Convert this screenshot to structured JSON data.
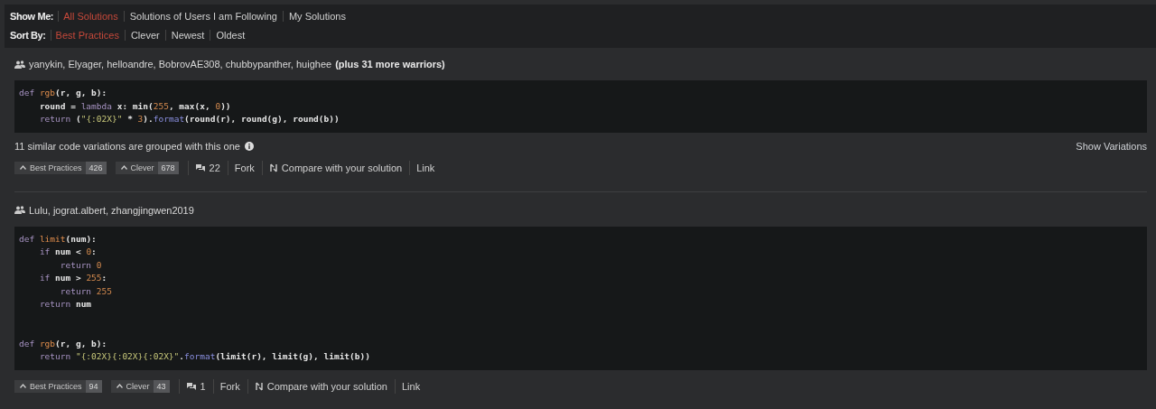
{
  "filters": [
    {
      "label": "Show Me:",
      "options": [
        {
          "label": "All Solutions",
          "selected": true
        },
        {
          "label": "Solutions of Users I am Following",
          "selected": false
        },
        {
          "label": "My Solutions",
          "selected": false
        }
      ]
    },
    {
      "label": "Sort By:",
      "options": [
        {
          "label": "Best Practices",
          "selected": true
        },
        {
          "label": "Clever",
          "selected": false
        },
        {
          "label": "Newest",
          "selected": false
        },
        {
          "label": "Oldest",
          "selected": false
        }
      ]
    }
  ],
  "solutions": [
    {
      "authors": "yanykin, Elyager, helloandre, BobrovAE308, chubbypanther, huighee",
      "more": "(plus 31 more warriors)",
      "code": [
        {
          "kind": "code",
          "tokens": [
            {
              "t": "def ",
              "kind": "keyword"
            },
            {
              "t": "rgb",
              "kind": "function"
            },
            {
              "t": "(r, g, b):",
              "kind": "plain"
            }
          ],
          "children": [
            {
              "kind": "code",
              "tokens": [
                {
                  "t": "round = ",
                  "kind": "plain"
                },
                {
                  "t": "lambda",
                  "kind": "keyword"
                },
                {
                  "t": " x: min(",
                  "kind": "plain"
                },
                {
                  "t": "255",
                  "kind": "number"
                },
                {
                  "t": ", max(x, ",
                  "kind": "plain"
                },
                {
                  "t": "0",
                  "kind": "number"
                },
                {
                  "t": "))",
                  "kind": "plain"
                }
              ]
            },
            {
              "kind": "code",
              "tokens": [
                {
                  "t": "return ",
                  "kind": "keyword"
                },
                {
                  "t": "(",
                  "kind": "plain"
                },
                {
                  "t": "\"{:02X}\"",
                  "kind": "string"
                },
                {
                  "t": " * ",
                  "kind": "plain"
                },
                {
                  "t": "3",
                  "kind": "number"
                },
                {
                  "t": ").",
                  "kind": "plain"
                },
                {
                  "t": "format",
                  "kind": "method"
                },
                {
                  "t": "(round(r), round(g), round(b))",
                  "kind": "plain"
                }
              ]
            }
          ]
        }
      ],
      "variations_note": "11 similar code variations are grouped with this one",
      "variations_link": "Show Variations",
      "votes": [
        {
          "label": "Best Practices",
          "count": "426"
        },
        {
          "label": "Clever",
          "count": "678"
        }
      ],
      "comments": "22",
      "actions": [
        "Fork",
        "Compare with your solution",
        "Link"
      ]
    },
    {
      "authors": "Lulu, jograt.albert, zhangjingwen2019",
      "code": [
        {
          "kind": "code",
          "tokens": [
            {
              "t": "def ",
              "kind": "keyword"
            },
            {
              "t": "limit",
              "kind": "function"
            },
            {
              "t": "(num):",
              "kind": "plain"
            }
          ],
          "children": [
            {
              "kind": "code",
              "tokens": [
                {
                  "t": "if ",
                  "kind": "keyword"
                },
                {
                  "t": "num < ",
                  "kind": "plain"
                },
                {
                  "t": "0",
                  "kind": "number"
                },
                {
                  "t": ":",
                  "kind": "plain"
                }
              ],
              "children": [
                {
                  "kind": "code",
                  "tokens": [
                    {
                      "t": "return ",
                      "kind": "keyword"
                    },
                    {
                      "t": "0",
                      "kind": "number"
                    }
                  ]
                }
              ]
            },
            {
              "kind": "code",
              "tokens": [
                {
                  "t": "if ",
                  "kind": "keyword"
                },
                {
                  "t": "num > ",
                  "kind": "plain"
                },
                {
                  "t": "255",
                  "kind": "number"
                },
                {
                  "t": ":",
                  "kind": "plain"
                }
              ],
              "children": [
                {
                  "kind": "code",
                  "tokens": [
                    {
                      "t": "return ",
                      "kind": "keyword"
                    },
                    {
                      "t": "255",
                      "kind": "number"
                    }
                  ]
                }
              ]
            },
            {
              "kind": "code",
              "tokens": [
                {
                  "t": "return ",
                  "kind": "keyword"
                },
                {
                  "t": "num",
                  "kind": "plain"
                }
              ]
            }
          ]
        },
        {
          "kind": "blank"
        },
        {
          "kind": "blank"
        },
        {
          "kind": "code",
          "tokens": [
            {
              "t": "def ",
              "kind": "keyword"
            },
            {
              "t": "rgb",
              "kind": "function"
            },
            {
              "t": "(r, g, b):",
              "kind": "plain"
            }
          ],
          "children": [
            {
              "kind": "code",
              "tokens": [
                {
                  "t": "return ",
                  "kind": "keyword"
                },
                {
                  "t": "\"{:02X}{:02X}{:02X}\"",
                  "kind": "string"
                },
                {
                  "t": ".",
                  "kind": "plain"
                },
                {
                  "t": "format",
                  "kind": "method"
                },
                {
                  "t": "(limit(r), limit(g), limit(b))",
                  "kind": "plain"
                }
              ]
            }
          ]
        }
      ],
      "votes": [
        {
          "label": "Best Practices",
          "count": "94"
        },
        {
          "label": "Clever",
          "count": "43"
        }
      ],
      "comments": "1",
      "actions": [
        "Fork",
        "Compare with your solution",
        "Link"
      ]
    }
  ]
}
